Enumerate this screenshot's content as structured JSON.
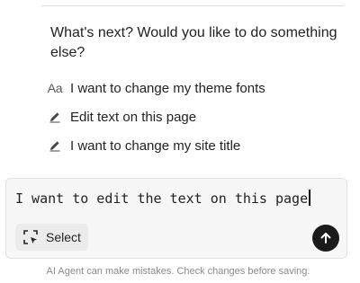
{
  "chat": {
    "question": "What's next? Would you like to do something else?",
    "suggestions": [
      {
        "icon": "font-icon",
        "label": "I want to change my theme fonts"
      },
      {
        "icon": "pencil-icon",
        "label": "Edit text on this page"
      },
      {
        "icon": "pencil-icon",
        "label": "I want to change my site title"
      }
    ],
    "font_icon_glyph": "Aa"
  },
  "composer": {
    "input_value": "I want to edit the text on this page",
    "select_label": "Select",
    "select_icon": "select-area-icon",
    "send_icon": "arrow-up-icon"
  },
  "footer": {
    "disclaimer": "AI Agent can make mistakes. Check changes before saving."
  },
  "colors": {
    "send_button": "#1a1a1a",
    "composer_bg": "#f7f7f7",
    "select_bg": "#ececec"
  }
}
